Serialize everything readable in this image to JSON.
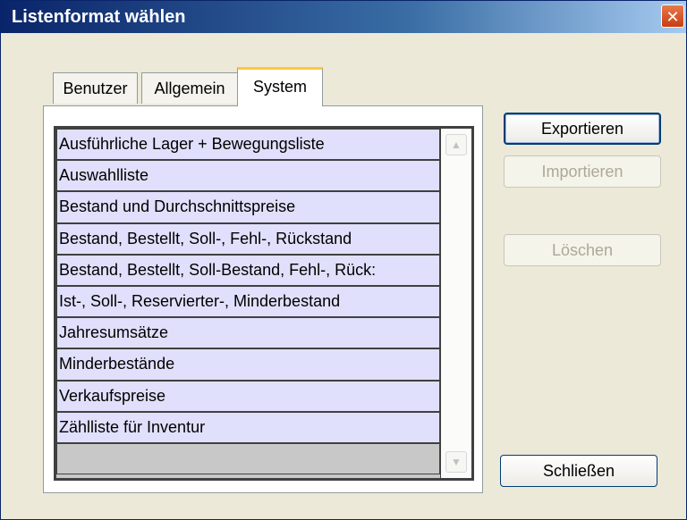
{
  "dialog": {
    "title": "Listenformat wählen",
    "close_glyph": "✕"
  },
  "tabs": [
    {
      "label": "Benutzer",
      "active": false
    },
    {
      "label": "Allgemein",
      "active": false
    },
    {
      "label": "System",
      "active": true
    }
  ],
  "list": {
    "items": [
      "Ausführliche Lager + Bewegungsliste",
      "Auswahlliste",
      "Bestand und Durchschnittspreise",
      "Bestand, Bestellt, Soll-, Fehl-, Rückstand",
      "Bestand, Bestellt, Soll-Bestand, Fehl-, Rück:",
      "Ist-, Soll-, Reservierter-, Minderbestand",
      "Jahresumsätze",
      "Minderbestände",
      "Verkaufspreise",
      "Zählliste für Inventur"
    ],
    "scroll_up_glyph": "▲",
    "scroll_down_glyph": "▼"
  },
  "buttons": {
    "export": "Exportieren",
    "import": "Importieren",
    "delete": "Löschen",
    "close": "Schließen"
  },
  "colors": {
    "row_background": "#e0e0fc",
    "title_bar": "#0a246a",
    "active_tab_accent": "#ffc83c"
  },
  "icons": {
    "close": "close-icon",
    "scroll_up": "chevron-up-icon",
    "scroll_down": "chevron-down-icon"
  }
}
